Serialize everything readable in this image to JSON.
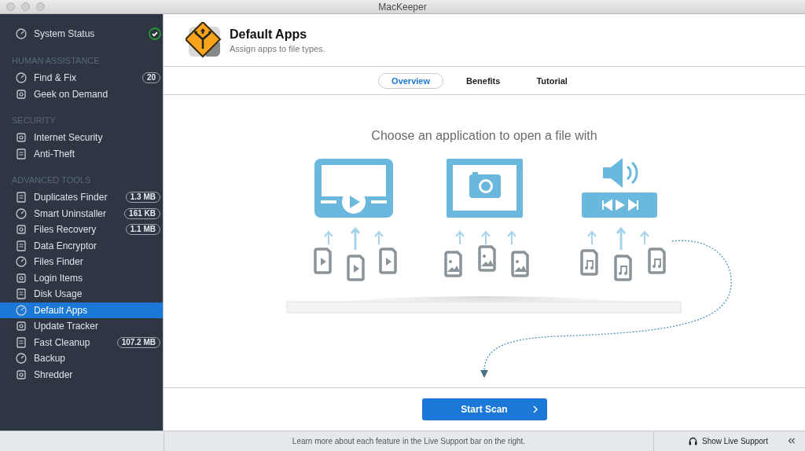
{
  "window": {
    "title": "MacKeeper"
  },
  "sidebar": {
    "top_item": {
      "label": "System Status"
    },
    "sections": [
      {
        "header": "HUMAN ASSISTANCE",
        "items": [
          {
            "label": "Find & Fix",
            "badge": "20",
            "selected": false
          },
          {
            "label": "Geek on Demand",
            "selected": false
          }
        ]
      },
      {
        "header": "SECURITY",
        "items": [
          {
            "label": "Internet Security",
            "selected": false
          },
          {
            "label": "Anti-Theft",
            "selected": false
          }
        ]
      },
      {
        "header": "ADVANCED TOOLS",
        "items": [
          {
            "label": "Duplicates Finder",
            "badge": "1.3 MB",
            "selected": false
          },
          {
            "label": "Smart Uninstaller",
            "badge": "161 KB",
            "selected": false
          },
          {
            "label": "Files Recovery",
            "badge": "1.1 MB",
            "selected": false
          },
          {
            "label": "Data Encryptor",
            "selected": false
          },
          {
            "label": "Files Finder",
            "selected": false
          },
          {
            "label": "Login Items",
            "selected": false
          },
          {
            "label": "Disk Usage",
            "selected": false
          },
          {
            "label": "Default Apps",
            "selected": true
          },
          {
            "label": "Update Tracker",
            "selected": false
          },
          {
            "label": "Fast Cleanup",
            "badge": "107.2 MB",
            "selected": false
          },
          {
            "label": "Backup",
            "selected": false
          },
          {
            "label": "Shredder",
            "selected": false
          }
        ]
      }
    ]
  },
  "header": {
    "title": "Default Apps",
    "subtitle": "Assign apps to file types."
  },
  "tabs": [
    {
      "label": "Overview",
      "selected": true
    },
    {
      "label": "Benefits",
      "selected": false
    },
    {
      "label": "Tutorial",
      "selected": false
    }
  ],
  "illustration": {
    "heading": "Choose an application to open a file with"
  },
  "primary_button": {
    "label": "Start Scan"
  },
  "status_bar": {
    "message": "Learn more about each feature in the Live Support bar on the right.",
    "support_button": "Show Live Support"
  }
}
